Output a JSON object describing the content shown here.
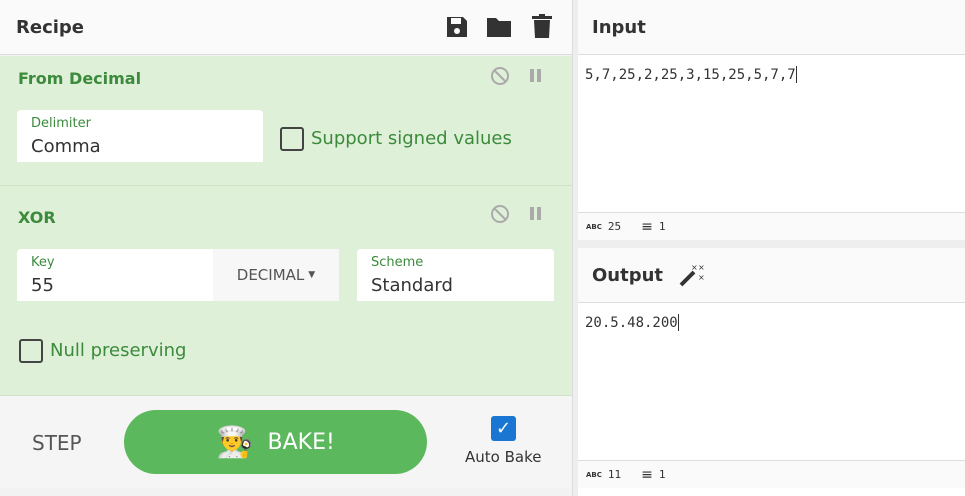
{
  "recipe": {
    "title": "Recipe",
    "icons": [
      "save-icon",
      "folder-icon",
      "trash-icon"
    ]
  },
  "operations": [
    {
      "name": "From Decimal",
      "fields": {
        "delimiter_label": "Delimiter",
        "delimiter_value": "Comma",
        "signed_label": "Support signed values",
        "signed_checked": false
      }
    },
    {
      "name": "XOR",
      "fields": {
        "key_label": "Key",
        "key_value": "55",
        "key_format": "DECIMAL",
        "scheme_label": "Scheme",
        "scheme_value": "Standard",
        "null_label": "Null preserving",
        "null_checked": false
      }
    }
  ],
  "controls": {
    "step": "STEP",
    "bake": "BAKE!",
    "auto_bake": "Auto Bake",
    "auto_bake_checked": true
  },
  "input": {
    "title": "Input",
    "value": "5,7,25,2,25,3,15,25,5,7,7",
    "length": "25",
    "lines": "1",
    "length_icon": "ABC"
  },
  "output": {
    "title": "Output",
    "value": "20.5.48.200",
    "length": "11",
    "lines": "1",
    "length_icon": "ABC"
  }
}
